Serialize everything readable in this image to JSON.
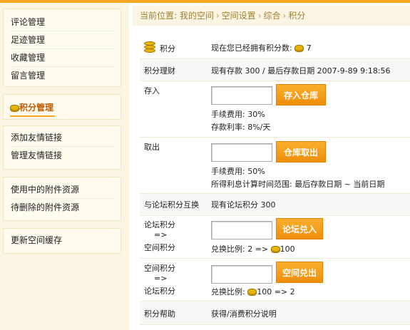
{
  "sidebar": {
    "group1": [
      "评论管理",
      "足迹管理",
      "收藏管理",
      "留言管理"
    ],
    "active": "积分管理",
    "group2": [
      "添加友情链接",
      "管理友情链接"
    ],
    "group3": [
      "使用中的附件资源",
      "待删除的附件资源"
    ],
    "group4": [
      "更新空间缓存"
    ]
  },
  "breadcrumb": {
    "prefix": "当前位置: 我的空间",
    "items": [
      "空间设置",
      "综合",
      "积分"
    ],
    "sep": "›"
  },
  "points": {
    "label": "积分",
    "text": "现在您已经拥有积分数:",
    "value": "7"
  },
  "finance": {
    "label": "积分理财",
    "text": "现有存款 300 / 最后存款日期 2007-9-89 9:18:56"
  },
  "deposit": {
    "label": "存入",
    "button": "存入仓库",
    "fee": "手续费用: 30%",
    "rate": "存款利率: 8%/天"
  },
  "withdraw": {
    "label": "取出",
    "button": "仓库取出",
    "fee": "手续费用: 50%",
    "range": "所得利息计算时间范围: 最后存款日期 ~ 当前日期"
  },
  "exchange": {
    "label": "与论坛积分互换",
    "text": "现有论坛积分 300"
  },
  "forum_to_space": {
    "label1": "论坛积分",
    "arrow": "=>",
    "label2": "空间积分",
    "button": "论坛兑入",
    "ratio_prefix": "兑换比例: 2 =>",
    "ratio_value": "100"
  },
  "space_to_forum": {
    "label1": "空间积分",
    "arrow": "=>",
    "label2": "论坛积分",
    "button": "空间兑出",
    "ratio_prefix": "兑换比例:",
    "ratio_suffix": "100 => 2"
  },
  "help": {
    "label": "积分帮助",
    "text": "获得/消费积分说明"
  }
}
